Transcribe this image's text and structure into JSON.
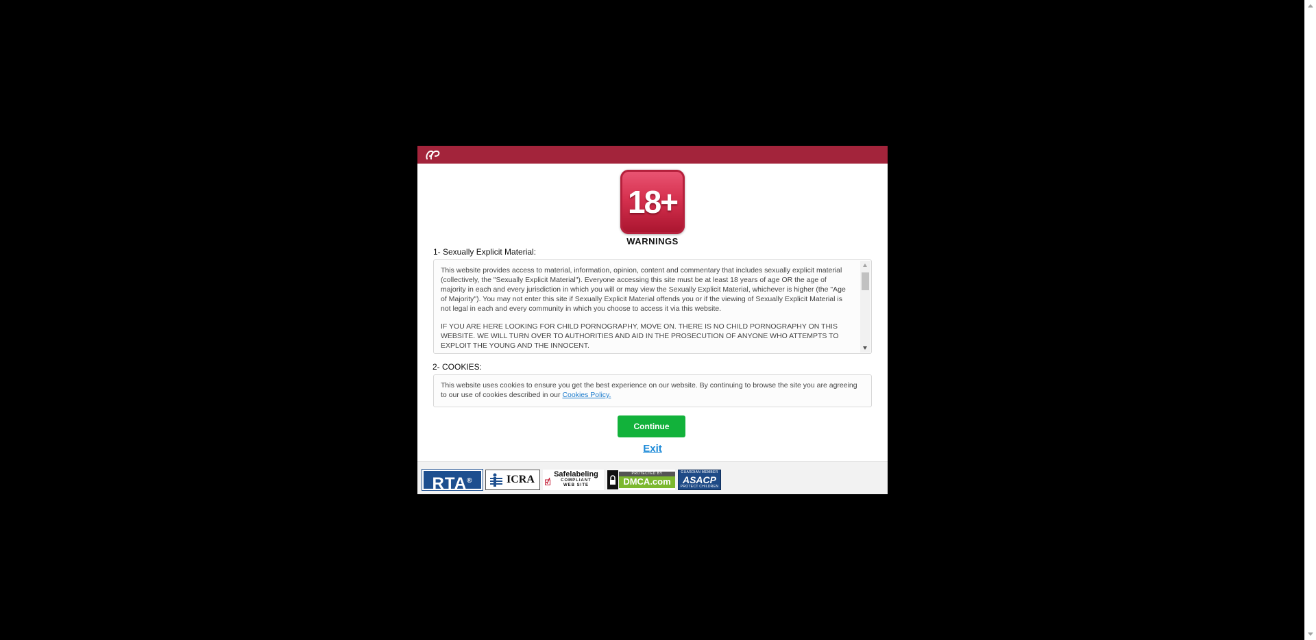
{
  "badge": {
    "label": "18+",
    "title": "WARNINGS"
  },
  "sections": {
    "explicit": {
      "label": "1- Sexually Explicit Material:",
      "paragraphs": [
        "This website provides access to material, information, opinion, content and commentary that includes sexually explicit material (collectively, the \"Sexually Explicit Material\"). Everyone accessing this site must be at least 18 years of age OR the age of majority in each and every jurisdiction in which you will or may view the Sexually Explicit Material, whichever is higher (the \"Age of Majority\"). You may not enter this site if Sexually Explicit Material offends you or if the viewing of Sexually Explicit Material is not legal in each and every community in which you choose to access it via this website.",
        "IF YOU ARE HERE LOOKING FOR CHILD PORNOGRAPHY, MOVE ON. THERE IS NO CHILD PORNOGRAPHY ON THIS WEBSITE. WE WILL TURN OVER TO AUTHORITIES AND AID IN THE PROSECUTION OF ANYONE WHO ATTEMPTS TO EXPLOIT THE YOUNG AND THE INNOCENT."
      ]
    },
    "cookies": {
      "label": "2- COOKIES:",
      "text": "This website uses cookies to ensure you get the best experience on our website. By continuing to browse the site you are agreeing to our use of cookies described in our ",
      "link": "Cookies Policy."
    }
  },
  "actions": {
    "continue_label": "Continue",
    "exit_label": "Exit"
  },
  "footer": {
    "rta": "RTA",
    "rta_mark": "®",
    "icra": "ICRA",
    "safelabeling": "Safelabeling",
    "safelabeling_sub1": "COMPLIANT",
    "safelabeling_sub2": "WEB SITE",
    "dmca_protected": "PROTECTED BY",
    "dmca": "DMCA.com",
    "asacp_top": "GUARDIAN MEMBER",
    "asacp": "ASACP",
    "asacp_bottom": "PROTECT CHILDREN"
  },
  "colors": {
    "header": "#a3243b",
    "continue": "#12b23b",
    "link": "#1c8ad8"
  }
}
